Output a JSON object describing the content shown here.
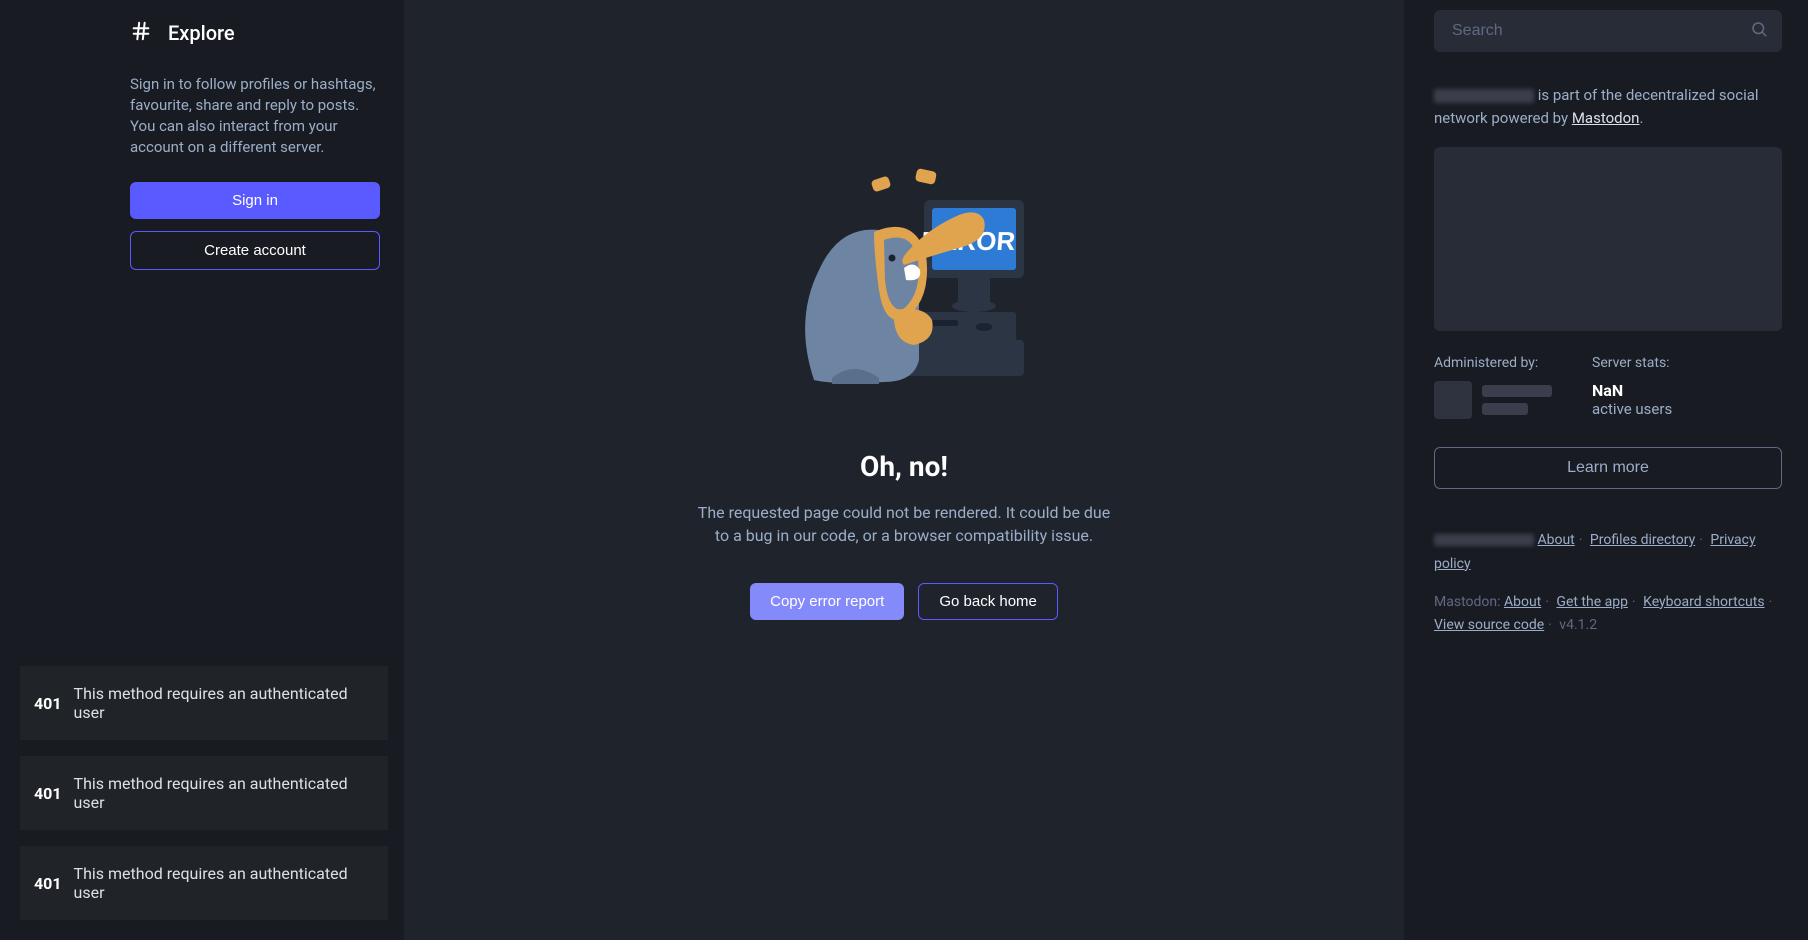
{
  "left": {
    "page_title": "Explore",
    "prompt": "Sign in to follow profiles or hashtags, favourite, share and reply to posts. You can also interact from your account on a different server.",
    "signin_label": "Sign in",
    "create_label": "Create account"
  },
  "toasts": [
    {
      "code": "401",
      "msg": "This method requires an authenticated user"
    },
    {
      "code": "401",
      "msg": "This method requires an authenticated user"
    },
    {
      "code": "401",
      "msg": "This method requires an authenticated user"
    }
  ],
  "error": {
    "screen_text": "ERROR",
    "title": "Oh, no!",
    "desc": "The requested page could not be rendered. It could be due to a bug in our code, or a browser compatibility issue.",
    "copy_label": "Copy error report",
    "home_label": "Go back home"
  },
  "right": {
    "search_placeholder": "Search",
    "about_suffix": " is part of the decentralized social network powered by ",
    "about_link": "Mastodon",
    "admin_label": "Administered by:",
    "stats_label": "Server stats:",
    "stats_value": "NaN",
    "stats_unit": "active users",
    "learn_more": "Learn more",
    "footer1": {
      "about": "About",
      "profiles": "Profiles directory",
      "privacy": "Privacy policy"
    },
    "footer2": {
      "prefix": "Mastodon: ",
      "about": "About",
      "getapp": "Get the app",
      "shortcuts": "Keyboard shortcuts",
      "source": "View source code",
      "version": "v4.1.2"
    }
  }
}
